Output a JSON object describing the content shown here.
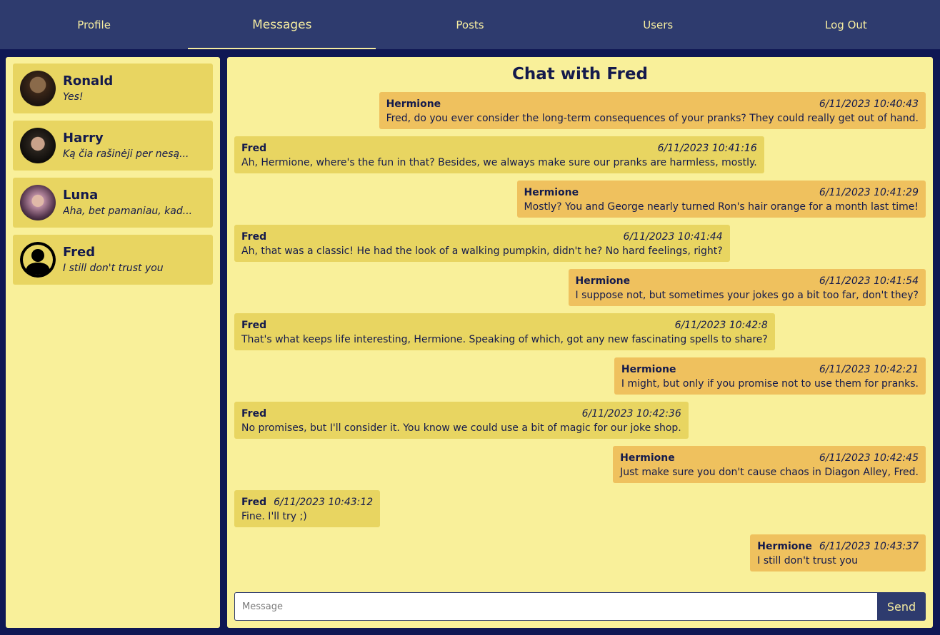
{
  "nav": {
    "items": [
      {
        "label": "Profile"
      },
      {
        "label": "Messages"
      },
      {
        "label": "Posts"
      },
      {
        "label": "Users"
      },
      {
        "label": "Log Out"
      }
    ],
    "active": "Messages"
  },
  "contacts": [
    {
      "name": "Ronald",
      "last": "Yes!",
      "avatar": "photo-avatar"
    },
    {
      "name": "Harry",
      "last": "Ką čia rašinėji per nesą...",
      "avatar": "photo-avatar"
    },
    {
      "name": "Luna",
      "last": "Aha, bet pamaniau, kad...",
      "avatar": "photo-avatar"
    },
    {
      "name": "Fred",
      "last": "I still don't trust you",
      "avatar": "default-user-icon"
    }
  ],
  "chat": {
    "title": "Chat with Fred",
    "messages": [
      {
        "author": "Hermione",
        "time": "6/11/2023 10:40:43",
        "text": "Fred, do you ever consider the long-term consequences of your pranks? They could really get out of hand.",
        "mine": true
      },
      {
        "author": "Fred",
        "time": "6/11/2023 10:41:16",
        "text": "Ah, Hermione, where's the fun in that? Besides, we always make sure our pranks are harmless, mostly.",
        "mine": false
      },
      {
        "author": "Hermione",
        "time": "6/11/2023 10:41:29",
        "text": "Mostly? You and George nearly turned Ron's hair orange for a month last time!",
        "mine": true
      },
      {
        "author": "Fred",
        "time": "6/11/2023 10:41:44",
        "text": "Ah, that was a classic! He had the look of a walking pumpkin, didn't he? No hard feelings, right?",
        "mine": false
      },
      {
        "author": "Hermione",
        "time": "6/11/2023 10:41:54",
        "text": "I suppose not, but sometimes your jokes go a bit too far, don't they?",
        "mine": true
      },
      {
        "author": "Fred",
        "time": "6/11/2023 10:42:8",
        "text": "That's what keeps life interesting, Hermione. Speaking of which, got any new fascinating spells to share?",
        "mine": false
      },
      {
        "author": "Hermione",
        "time": "6/11/2023 10:42:21",
        "text": "I might, but only if you promise not to use them for pranks.",
        "mine": true
      },
      {
        "author": "Fred",
        "time": "6/11/2023 10:42:36",
        "text": "No promises, but I'll consider it. You know we could use a bit of magic for our joke shop.",
        "mine": false
      },
      {
        "author": "Hermione",
        "time": "6/11/2023 10:42:45",
        "text": "Just make sure you don't cause chaos in Diagon Alley, Fred.",
        "mine": true
      },
      {
        "author": "Fred",
        "time": "6/11/2023 10:43:12",
        "text": "Fine. I'll try ;)",
        "mine": false
      },
      {
        "author": "Hermione",
        "time": "6/11/2023 10:43:37",
        "text": "I still don't trust you",
        "mine": true
      }
    ]
  },
  "composer": {
    "placeholder": "Message",
    "value": "",
    "send_label": "Send"
  },
  "colors": {
    "nav_bg": "#2e3b6e",
    "page_bg": "#0f1754",
    "panel_bg": "#f9f09a",
    "bubble_theirs": "#e8d561",
    "bubble_mine": "#efc15e",
    "accent_text": "#f5eca0"
  }
}
